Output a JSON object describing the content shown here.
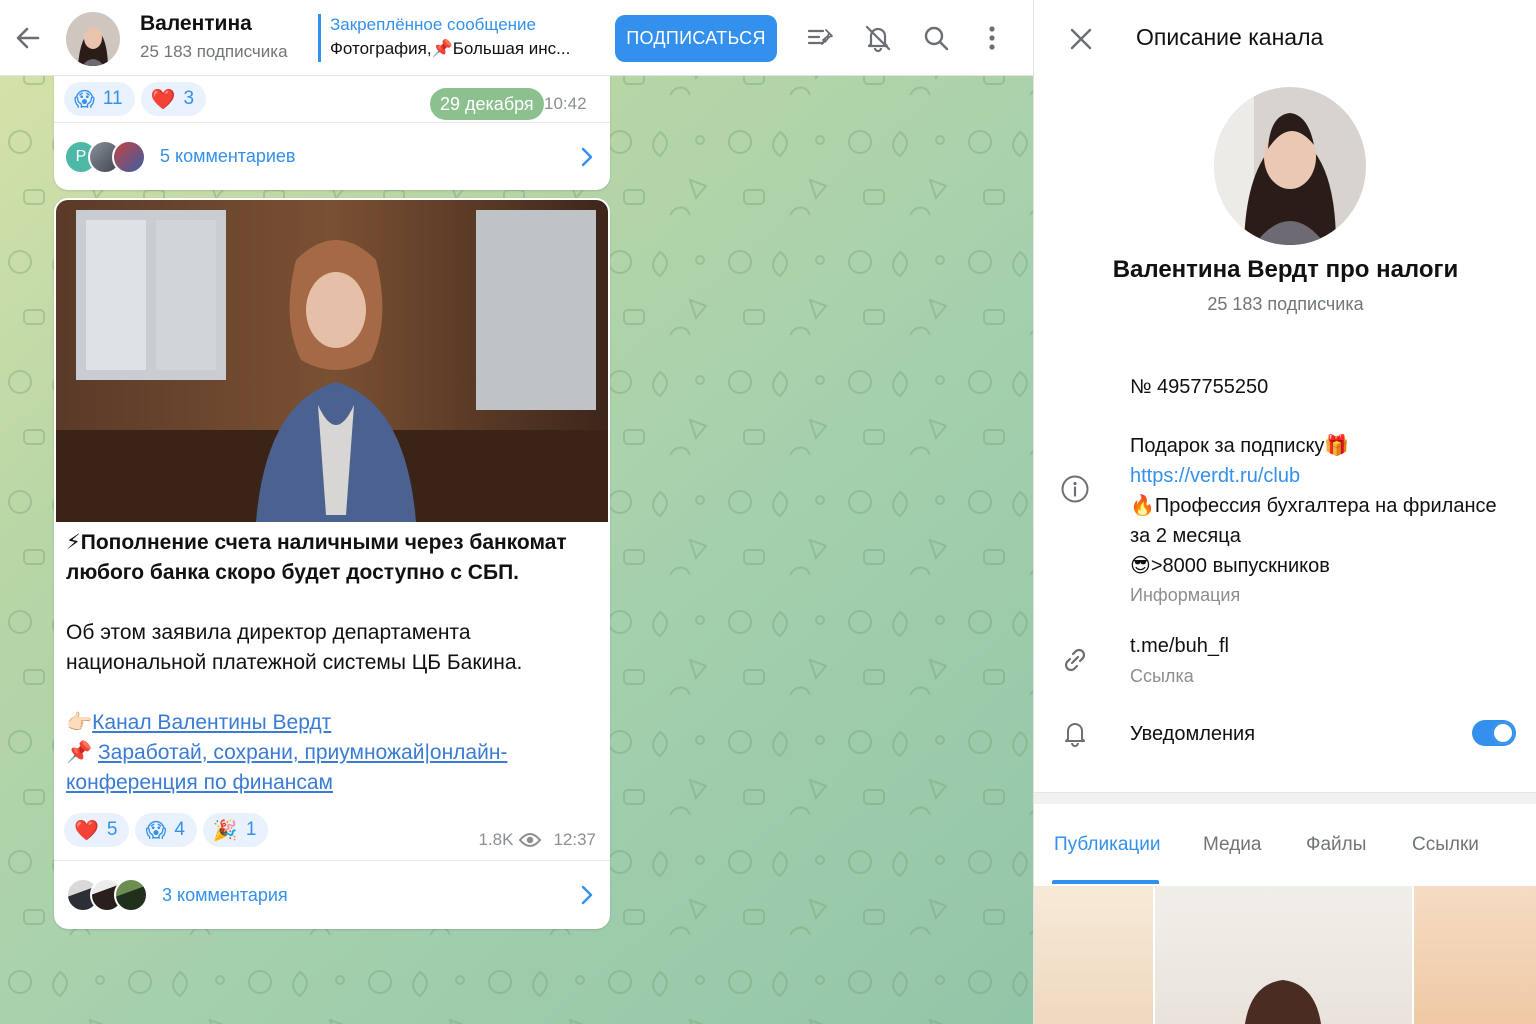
{
  "header": {
    "name": "Валентина",
    "subscribers": "25 183 подписчика",
    "pinned_title": "Закреплённое сообщение",
    "pinned_text": "Фотография,📌Большая инс...",
    "subscribe_label": "ПОДПИСАТЬСЯ",
    "icons": [
      "back-arrow-icon",
      "pinned-list-icon",
      "bell-off-icon",
      "search-icon",
      "more-vertical-icon"
    ]
  },
  "post1": {
    "reactions": [
      {
        "emoji": "😱",
        "count": "11"
      },
      {
        "emoji": "❤️",
        "count": "3"
      }
    ],
    "date_badge": "29 декабря",
    "time": "10:42",
    "first_avatar_letter": "Р",
    "comments": "5 комментариев"
  },
  "post2": {
    "title_emoji": "⚡",
    "title": "Пополнение счета наличными через банкомат любого банка скоро будет доступно с СБП.",
    "paragraph": "Об этом заявила директор департамента национальной платежной системы ЦБ Бакина.",
    "link1_emoji": "👉🏻",
    "link1": "Канал Валентины Вердт",
    "link2_emoji": "📌",
    "link2": "Заработай, сохрани, приумножай|онлайн-конференция по финансам",
    "reactions": [
      {
        "emoji": "❤️",
        "count": "5"
      },
      {
        "emoji": "😱",
        "count": "4"
      },
      {
        "emoji": "🎉",
        "count": "1"
      }
    ],
    "views": "1.8K",
    "time": "12:37",
    "comments": "3 комментария"
  },
  "panel": {
    "title": "Описание канала",
    "channel_name": "Валентина Вердт про налоги",
    "subscribers": "25 183 подписчика",
    "number": "№ 4957755250",
    "gift_line": "Подарок за подписку🎁",
    "gift_link": "https://verdt.ru/club",
    "course_line": "🔥Профессия бухгалтера на фрилансе за 2 месяца",
    "graduates_line": "😎>8000 выпускников",
    "info_label": "Информация",
    "link": "t.me/buh_fl",
    "link_label": "Ссылка",
    "notifications_label": "Уведомления",
    "notifications_on": true,
    "tabs": [
      "Публикации",
      "Медиа",
      "Файлы",
      "Ссылки"
    ],
    "active_tab": "Публикации"
  },
  "colors": {
    "accent": "#3390ec",
    "chat_bg_start": "#d9e3a9",
    "chat_bg_end": "#92c6a8"
  }
}
